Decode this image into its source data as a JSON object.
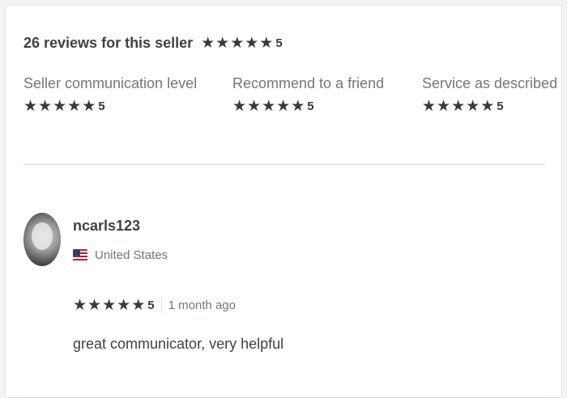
{
  "summary": {
    "title": "26 reviews for this seller",
    "rating": "5",
    "stars": 5
  },
  "breakdown": [
    {
      "label": "Seller communication level",
      "rating": "5"
    },
    {
      "label": "Recommend to a friend",
      "rating": "5"
    },
    {
      "label": "Service as described",
      "rating": "5"
    }
  ],
  "review": {
    "username": "ncarls123",
    "country": "United States",
    "rating": "5",
    "time_ago": "1 month ago",
    "text": "great communicator, very helpful"
  },
  "icons": {
    "star": "star-icon",
    "flag": "us-flag-icon",
    "avatar": "user-avatar"
  },
  "colors": {
    "star": "#3a3a3a",
    "text_primary": "#404145",
    "text_secondary": "#74767e",
    "divider": "#dadbdd"
  }
}
